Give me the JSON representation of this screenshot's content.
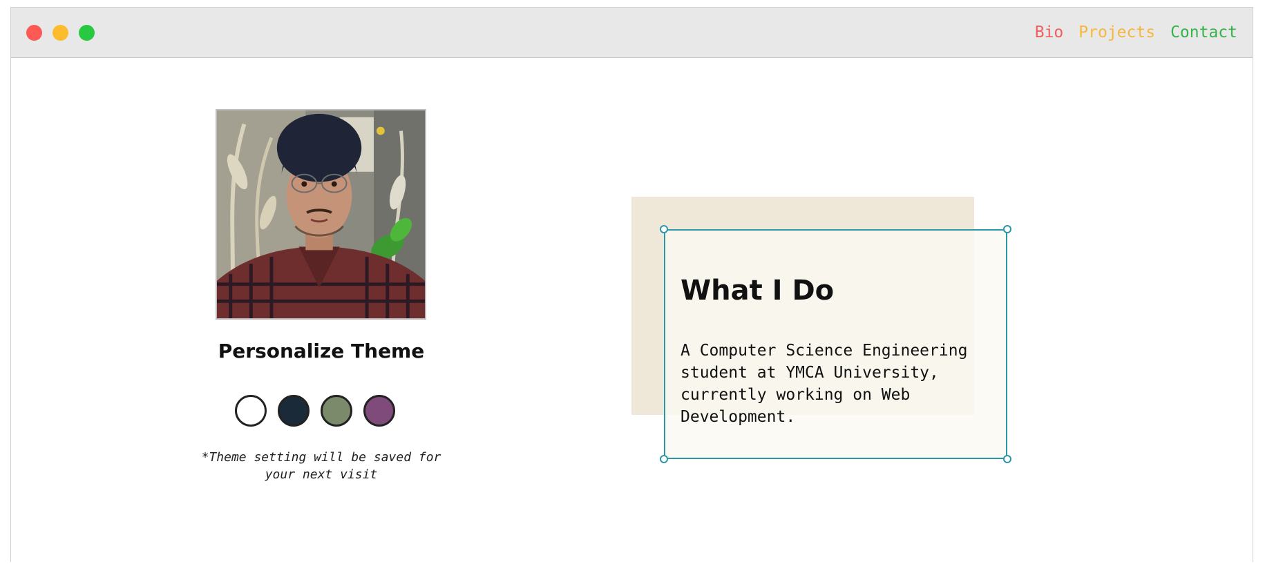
{
  "window": {
    "controls": {
      "close_color": "#fd5a55",
      "minimize_color": "#fdbb2e",
      "maximize_color": "#28c840"
    }
  },
  "nav": {
    "items": [
      {
        "label": "Bio",
        "color": "#f06060"
      },
      {
        "label": "Projects",
        "color": "#f6b73c"
      },
      {
        "label": "Contact",
        "color": "#35b34a"
      }
    ]
  },
  "profile": {
    "photo_icon": "profile-photo"
  },
  "theme": {
    "title": "Personalize Theme",
    "swatches": [
      {
        "name": "light",
        "color": "#ffffff"
      },
      {
        "name": "dark-blue",
        "color": "#1b2a38"
      },
      {
        "name": "green",
        "color": "#7a8a6a"
      },
      {
        "name": "purple",
        "color": "#7e4b7b"
      }
    ],
    "note": "*Theme setting will be saved for your next visit"
  },
  "about": {
    "heading": "What I Do",
    "body": "A Computer Science Engineering student at YMCA University, currently working on Web Development.",
    "accent_color": "#2a97a8"
  }
}
